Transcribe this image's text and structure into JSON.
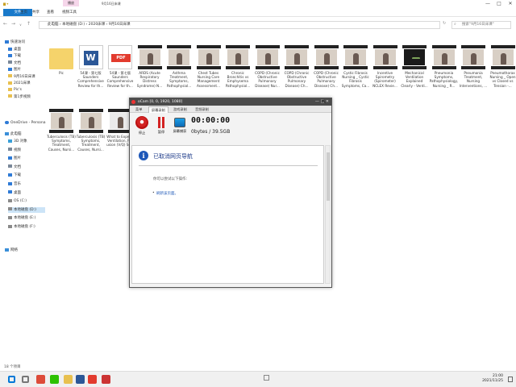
{
  "titlebar": {
    "context_tab": "播放",
    "title": "9月16日床课",
    "controls": [
      "—",
      "□",
      "✕"
    ]
  },
  "ribbon": {
    "tabs": [
      "文件",
      "主页",
      "共享",
      "查看",
      "视频工具"
    ]
  },
  "address": {
    "path": "此电脑  ›  本地磁盘 (D:)  ›  2020床课  ›  9月16日床课",
    "search_placeholder": "搜索\"9月16日床课\""
  },
  "nav": {
    "quick_access": "快速访问",
    "items": [
      {
        "label": "桌面",
        "color": "#2f7bd6"
      },
      {
        "label": "下载",
        "color": "#2f7bd6"
      },
      {
        "label": "文档",
        "color": "#7a8899"
      },
      {
        "label": "图片",
        "color": "#2f7bd6"
      },
      {
        "label": "9月16日床课",
        "color": "#e8c04f"
      },
      {
        "label": "2021床课",
        "color": "#e8c04f"
      },
      {
        "label": "Pic's",
        "color": "#e8c04f"
      },
      {
        "label": "第1步视频",
        "color": "#e8c04f"
      }
    ],
    "onedrive": "OneDrive - Persona",
    "this_pc": "此电脑",
    "pc_items": [
      {
        "label": "3D 对象",
        "color": "#3aa0d8"
      },
      {
        "label": "视频",
        "color": "#7a8899"
      },
      {
        "label": "图片",
        "color": "#2f7bd6"
      },
      {
        "label": "文档",
        "color": "#7a8899"
      },
      {
        "label": "下载",
        "color": "#2f7bd6"
      },
      {
        "label": "音乐",
        "color": "#2f7bd6"
      },
      {
        "label": "桌面",
        "color": "#2f7bd6"
      },
      {
        "label": "OS (C:)",
        "color": "#8a8a8a"
      },
      {
        "label": "本地磁盘 (D:)",
        "color": "#8a8a8a"
      },
      {
        "label": "本地磁盘 (E:)",
        "color": "#8a8a8a"
      },
      {
        "label": "本地磁盘 (F:)",
        "color": "#8a8a8a"
      }
    ],
    "network": "网络"
  },
  "files_row1": [
    {
      "label": "Pic",
      "kind": "folder"
    },
    {
      "label": "54课 - 第七版 Saunders Comprehensive Review for th...",
      "kind": "word"
    },
    {
      "label": "54课 - 第七版 Saunders Comprehensive Review for th...",
      "kind": "pdf"
    },
    {
      "label": "ARDS (Acute Respiratory Distress Syndrome) N...",
      "kind": "video"
    },
    {
      "label": "Asthma Treatment, Symptoms, Pathophysiol...",
      "kind": "video"
    },
    {
      "label": "Chest Tubes Nursing Care Management Assessment...",
      "kind": "video"
    },
    {
      "label": "Chronic Bronchitis vs Emphysema Pathophysiol...",
      "kind": "video"
    },
    {
      "label": "COPD (Chronic Obstructive Pulmonary Disease) Nur...",
      "kind": "video"
    },
    {
      "label": "COPD (Chronic Obstructive Pulmonary Disease) Ch...",
      "kind": "video"
    },
    {
      "label": "COPD (Chronic Obstructive Pulmonary Disease) Ch...",
      "kind": "video"
    },
    {
      "label": "Cystic Fibrosis Nursing _ Cystic Fibrosis Symptoms, Ca...",
      "kind": "video"
    },
    {
      "label": "Incentive Spirometry (Spirometer) NCLEX Revie...",
      "kind": "video"
    },
    {
      "label": "Mechanical Ventilation Explained Clearly - Venti...",
      "kind": "dark"
    },
    {
      "label": "Pneumonia Symptoms, Pathophysiology, Nursing _ R...",
      "kind": "video"
    },
    {
      "label": "Pneumonia Treatment, Nursing Interventions, ...",
      "kind": "video"
    },
    {
      "label": "Pneumothorax Nursing _ Open vs Closed vs Tension -...",
      "kind": "video"
    }
  ],
  "files_row2": [
    {
      "label": "Tuberculosis (TB) Symptoms, Treatment, Causes, Nursi...",
      "kind": "video"
    },
    {
      "label": "Tuberculosis (TB) Symptoms, Treatment, Causes, Nursi...",
      "kind": "video"
    },
    {
      "label": "What to Expect, Ventilation, Per usion (V/Q) Sc...",
      "kind": "slide"
    }
  ],
  "status": {
    "count": "18 个项目"
  },
  "taskbar": {
    "time": "21:00",
    "date": "2021/11/25",
    "icons": [
      {
        "name": "windows",
        "color": "#0078d7"
      },
      {
        "name": "search",
        "color": "#777777"
      },
      {
        "name": "chrome",
        "color": "#dd4b39"
      },
      {
        "name": "wechat",
        "color": "#2dc100"
      },
      {
        "name": "explorer",
        "color": "#e8c04f"
      },
      {
        "name": "word",
        "color": "#2b5797"
      },
      {
        "name": "acrobat",
        "color": "#e23b2e"
      },
      {
        "name": "ocam",
        "color": "#cc3333"
      }
    ]
  },
  "ocam": {
    "title": "oCam [0, 0, 1920, 1080]",
    "controls": "—  □  ✕",
    "tabs": [
      "菜单",
      "屏幕录制",
      "游戏录制",
      "音频录制"
    ],
    "buttons": {
      "stop": "停止",
      "pause": "暂停",
      "screen": "屏幕捕获"
    },
    "timer": "00:00:00",
    "size": "0bytes / 39.5GB",
    "body": {
      "heading": "已取消网页导航",
      "try_text": "你可以尝试以下操作:",
      "refresh_link": "刷新该页面。"
    }
  }
}
